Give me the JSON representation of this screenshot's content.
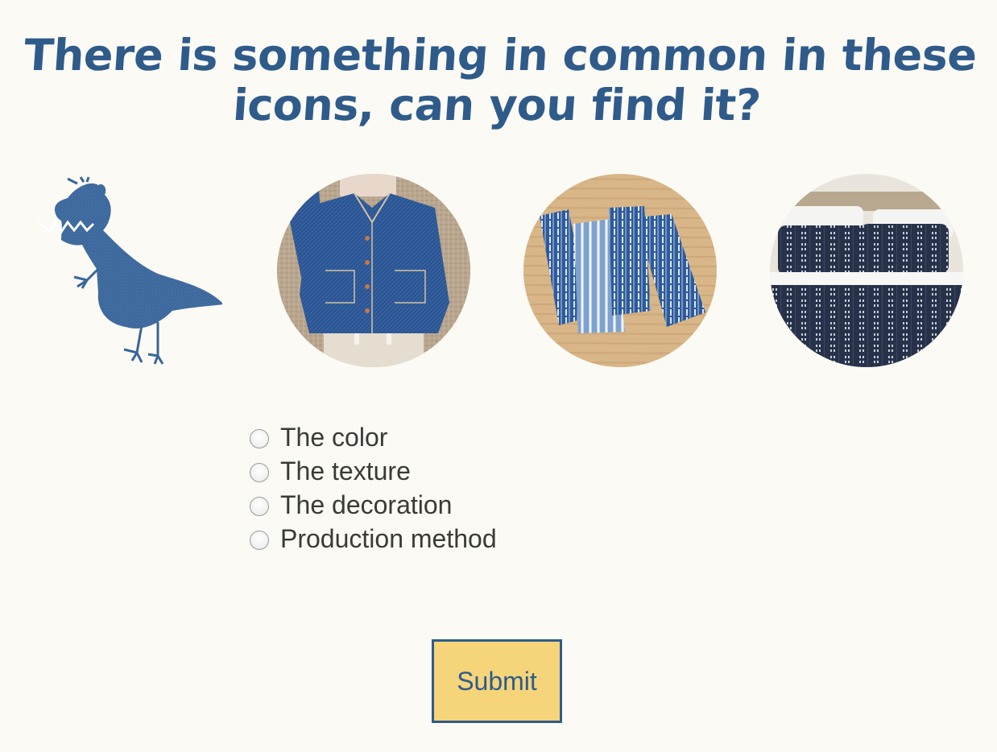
{
  "question": {
    "title": "There is something in common in these icons, can you find it?"
  },
  "icons": [
    {
      "name": "denim-dinosaur-icon"
    },
    {
      "name": "denim-jacket-image"
    },
    {
      "name": "striped-napkins-image"
    },
    {
      "name": "indigo-bedding-image"
    }
  ],
  "options": [
    {
      "label": "The color"
    },
    {
      "label": "The texture"
    },
    {
      "label": "The decoration"
    },
    {
      "label": "Production method"
    }
  ],
  "submit": {
    "label": "Submit"
  },
  "colors": {
    "accent": "#2f5b8a",
    "background": "#fbfaf5",
    "button_fill": "#f5d47a",
    "denim": "#3a6699"
  }
}
